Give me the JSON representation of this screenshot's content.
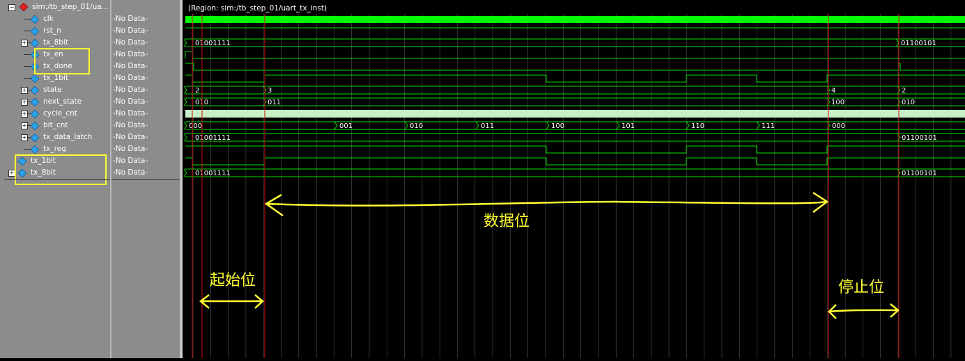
{
  "root": {
    "label": "sim:/tb_step_01/ua...",
    "expander": "−"
  },
  "signals": [
    {
      "name": "clk",
      "value": "-No Data-",
      "indent": 1,
      "expandable": false,
      "kind": "bit"
    },
    {
      "name": "rst_n",
      "value": "-No Data-",
      "indent": 1,
      "expandable": false,
      "kind": "bit"
    },
    {
      "name": "tx_8bit",
      "value": "-No Data-",
      "indent": 1,
      "expandable": true,
      "kind": "bus"
    },
    {
      "name": "tx_en",
      "value": "-No Data-",
      "indent": 1,
      "expandable": false,
      "kind": "bit"
    },
    {
      "name": "tx_done",
      "value": "-No Data-",
      "indent": 1,
      "expandable": false,
      "kind": "bit"
    },
    {
      "name": "tx_1bit",
      "value": "-No Data-",
      "indent": 1,
      "expandable": false,
      "kind": "bit"
    },
    {
      "name": "state",
      "value": "-No Data-",
      "indent": 1,
      "expandable": true,
      "kind": "bus"
    },
    {
      "name": "next_state",
      "value": "-No Data-",
      "indent": 1,
      "expandable": true,
      "kind": "bus"
    },
    {
      "name": "cycle_cnt",
      "value": "-No Data-",
      "indent": 1,
      "expandable": true,
      "kind": "bus"
    },
    {
      "name": "bit_cnt",
      "value": "-No Data-",
      "indent": 1,
      "expandable": true,
      "kind": "bus"
    },
    {
      "name": "tx_data_latch",
      "value": "-No Data-",
      "indent": 1,
      "expandable": true,
      "kind": "bus"
    },
    {
      "name": "tx_reg",
      "value": "-No Data-",
      "indent": 1,
      "expandable": false,
      "kind": "bit"
    },
    {
      "name": "tx_1bit",
      "value": "-No Data-",
      "indent": 0,
      "expandable": false,
      "kind": "bit"
    },
    {
      "name": "tx_8bit",
      "value": "-No Data-",
      "indent": 0,
      "expandable": true,
      "kind": "bus"
    }
  ],
  "wave": {
    "region_label": "(Region: sim:/tb_step_01/uart_tx_inst)",
    "bus_labels": {
      "tx_8bit": [
        "01001111",
        "01100101"
      ],
      "state": [
        "2",
        "3",
        "4",
        "2"
      ],
      "next_state": [
        "010",
        "011",
        "100",
        "010"
      ],
      "bit_cnt": [
        "000",
        "001",
        "010",
        "011",
        "100",
        "101",
        "110",
        "111",
        "000"
      ],
      "tx_data_latch": [
        "01001111",
        "01100101"
      ],
      "tx_8bit_top": [
        "01001111",
        "01100101"
      ]
    }
  },
  "annotations": {
    "data_bits": "数据位",
    "start_bit": "起始位",
    "stop_bit": "停止位"
  },
  "colors": {
    "signal_green": "#00e000",
    "clk_green": "#00ff00",
    "cycle_cnt_fill": "#c8f0c8",
    "cursor_red": "#d01010",
    "grid": "#9a9a9a",
    "highlight": "#ffff33",
    "panel_bg": "#8c8c8c"
  }
}
